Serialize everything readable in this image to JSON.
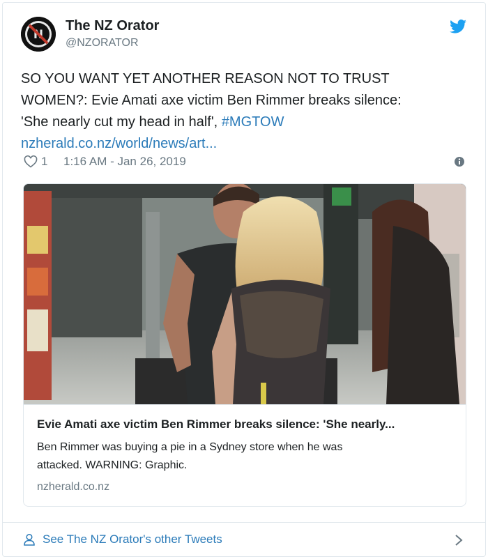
{
  "tweet": {
    "author": {
      "name": "The NZ Orator",
      "handle": "@NZORATOR",
      "avatar_icon": "nz-orator-logo"
    },
    "text_lines": [
      "SO YOU WANT YET ANOTHER REASON NOT TO TRUST",
      "WOMEN?: Evie Amati axe victim Ben Rimmer breaks silence:",
      "'She nearly cut my head in half',"
    ],
    "hashtag": "#MGTOW",
    "link_text": "nzherald.co.nz/world/news/art...",
    "likes": "1",
    "timestamp": "1:16 AM - Jan 26, 2019",
    "icons": {
      "brand": "twitter-bird-icon",
      "like": "heart-icon",
      "info": "info-icon",
      "footer": "person-icon",
      "chevron": "chevron-right-icon"
    },
    "colors": {
      "link": "#2b7bb9",
      "muted": "#697882",
      "twitter_blue": "#1da1f2"
    }
  },
  "link_card": {
    "title": "Evie Amati axe victim Ben Rimmer breaks silence: 'She nearly...",
    "description_lines": [
      "Ben Rimmer was buying a pie in a Sydney store when he was",
      "attacked. WARNING: Graphic."
    ],
    "domain": "nzherald.co.nz"
  },
  "footer": {
    "label": "See The NZ Orator's other Tweets"
  }
}
